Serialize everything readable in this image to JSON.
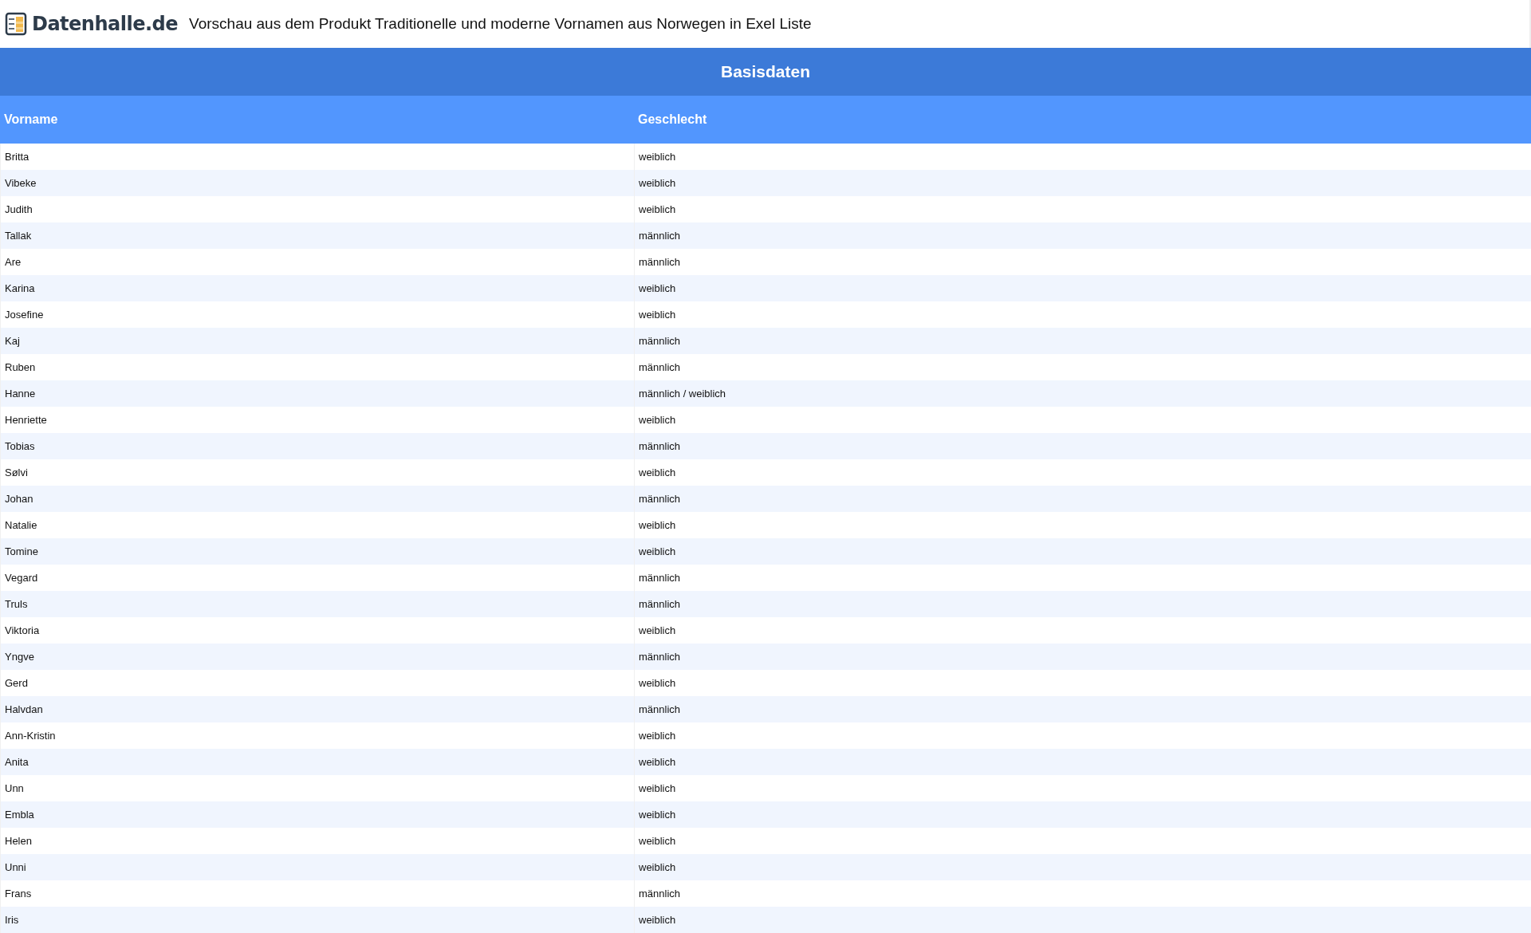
{
  "header": {
    "logo_text": "Datenhalle.de",
    "title": "Vorschau aus dem Produkt Traditionelle und moderne Vornamen aus Norwegen in Exel Liste"
  },
  "table": {
    "group_title": "Basisdaten",
    "columns": [
      "Vorname",
      "Geschlecht"
    ],
    "rows": [
      [
        "Britta",
        "weiblich"
      ],
      [
        "Vibeke",
        "weiblich"
      ],
      [
        "Judith",
        "weiblich"
      ],
      [
        "Tallak",
        "männlich"
      ],
      [
        "Are",
        "männlich"
      ],
      [
        "Karina",
        "weiblich"
      ],
      [
        "Josefine",
        "weiblich"
      ],
      [
        "Kaj",
        "männlich"
      ],
      [
        "Ruben",
        "männlich"
      ],
      [
        "Hanne",
        "männlich / weiblich"
      ],
      [
        "Henriette",
        "weiblich"
      ],
      [
        "Tobias",
        "männlich"
      ],
      [
        "Sølvi",
        "weiblich"
      ],
      [
        "Johan",
        "männlich"
      ],
      [
        "Natalie",
        "weiblich"
      ],
      [
        "Tomine",
        "weiblich"
      ],
      [
        "Vegard",
        "männlich"
      ],
      [
        "Truls",
        "männlich"
      ],
      [
        "Viktoria",
        "weiblich"
      ],
      [
        "Yngve",
        "männlich"
      ],
      [
        "Gerd",
        "weiblich"
      ],
      [
        "Halvdan",
        "männlich"
      ],
      [
        "Ann-Kristin",
        "weiblich"
      ],
      [
        "Anita",
        "weiblich"
      ],
      [
        "Unn",
        "weiblich"
      ],
      [
        "Embla",
        "weiblich"
      ],
      [
        "Helen",
        "weiblich"
      ],
      [
        "Unni",
        "weiblich"
      ],
      [
        "Frans",
        "männlich"
      ],
      [
        "Iris",
        "weiblich"
      ]
    ]
  }
}
